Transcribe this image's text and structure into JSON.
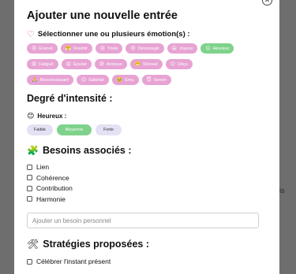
{
  "background": {
    "side_text": "is"
  },
  "modal": {
    "title": "Ajouter une nouvelle entrée",
    "close_glyph": "✕",
    "emotions_prompt": "Sélectionner une ou plusieurs émotion(s) :",
    "emotions_rows": [
      [
        {
          "label": "Énervé",
          "emoji": "😠",
          "selected": false
        },
        {
          "label": "Frustré",
          "emoji": "😤",
          "selected": false
        },
        {
          "label": "Triste",
          "emoji": "😢",
          "selected": false
        },
        {
          "label": "Découragé",
          "emoji": "😞",
          "selected": false
        },
        {
          "label": "Joyeux",
          "emoji": "😄",
          "selected": false
        },
        {
          "label": "Heureux",
          "emoji": "😊",
          "selected": true
        }
      ],
      [
        {
          "label": "Fatigué",
          "emoji": "😩",
          "selected": false
        },
        {
          "label": "Épuisé",
          "emoji": "😫",
          "selected": false
        },
        {
          "label": "Anxieux",
          "emoji": "😰",
          "selected": false
        },
        {
          "label": "Stressé",
          "emoji": "😬",
          "selected": false
        },
        {
          "label": "Déçu",
          "emoji": "😕",
          "selected": false
        }
      ],
      [
        {
          "label": "Reconnaissant",
          "emoji": "🙏",
          "selected": false
        },
        {
          "label": "Satisfait",
          "emoji": "😌",
          "selected": false
        },
        {
          "label": "Ému",
          "emoji": "🥹",
          "selected": false
        },
        {
          "label": "Serein",
          "emoji": "😇",
          "selected": false
        }
      ]
    ],
    "intensity_title": "Degré d'intensité :",
    "intensity_emotion": {
      "emoji": "😊",
      "label": "Heureux :"
    },
    "intensity_levels": [
      {
        "label": "Faible",
        "selected": false
      },
      {
        "label": "Moyenne",
        "selected": true
      },
      {
        "label": "Forte",
        "selected": false
      }
    ],
    "needs_title": "Besoins associés :",
    "needs_icon": "🧩",
    "needs": [
      "Lien",
      "Cohérence",
      "Contribution",
      "Harmonie"
    ],
    "custom_need_placeholder": "Ajouter un besoin personnel",
    "strategies_title": "Stratégies proposées :",
    "strategies_icon": "🛠",
    "strategies": [
      "Célébrer l'instant présent"
    ]
  },
  "colors": {
    "chip": "#e7a3d3",
    "chip_selected": "#7fd28b",
    "level": "#e4e1f4",
    "heart": "#d94f8c"
  }
}
